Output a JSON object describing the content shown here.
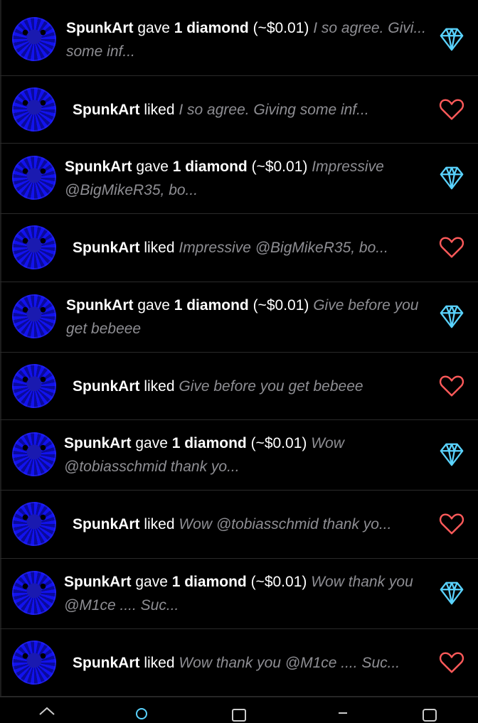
{
  "colors": {
    "diamond": "#5ad3ff",
    "heart": "#ff5a5a",
    "muted": "#8e8e93"
  },
  "notifications": [
    {
      "type": "diamond",
      "user": "SpunkArt",
      "verb": " gave ",
      "amount": "1 diamond",
      "price": " (~$0.01) ",
      "message": "I so agree. Givi... some inf...",
      "icon": "diamond-icon"
    },
    {
      "type": "like",
      "user": "SpunkArt",
      "verb": " liked ",
      "message": "I so agree. Giving some inf...",
      "icon": "heart-icon"
    },
    {
      "type": "diamond",
      "user": "SpunkArt",
      "verb": " gave ",
      "amount": "1 diamond",
      "price": " (~$0.01) ",
      "message": "Impressive @BigMikeR35, bo...",
      "icon": "diamond-icon"
    },
    {
      "type": "like",
      "user": "SpunkArt",
      "verb": " liked ",
      "message": "Impressive @BigMikeR35, bo...",
      "icon": "heart-icon"
    },
    {
      "type": "diamond",
      "user": "SpunkArt",
      "verb": " gave ",
      "amount": "1 diamond",
      "price": " (~$0.01) ",
      "message": "Give before you get bebeee",
      "icon": "diamond-icon"
    },
    {
      "type": "like",
      "user": "SpunkArt",
      "verb": " liked ",
      "message": "Give before you get bebeee",
      "icon": "heart-icon"
    },
    {
      "type": "diamond",
      "user": "SpunkArt",
      "verb": " gave ",
      "amount": "1 diamond",
      "price": " (~$0.01) ",
      "message": "Wow @tobiasschmid thank yo...",
      "icon": "diamond-icon"
    },
    {
      "type": "like",
      "user": "SpunkArt",
      "verb": " liked ",
      "message": "Wow @tobiasschmid thank yo...",
      "icon": "heart-icon"
    },
    {
      "type": "diamond",
      "user": "SpunkArt",
      "verb": " gave ",
      "amount": "1 diamond",
      "price": " (~$0.01) ",
      "message": "Wow thank you @M1ce .... Suc...",
      "icon": "diamond-icon"
    },
    {
      "type": "like",
      "user": "SpunkArt",
      "verb": " liked ",
      "message": "Wow thank you @M1ce .... Suc...",
      "icon": "heart-icon"
    }
  ],
  "tabs": [
    {
      "icon": "home-icon"
    },
    {
      "icon": "search-icon"
    },
    {
      "icon": "wallet-icon"
    },
    {
      "icon": "notifications-icon"
    },
    {
      "icon": "profile-icon"
    }
  ]
}
